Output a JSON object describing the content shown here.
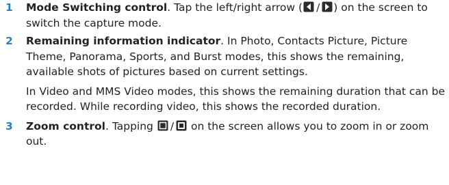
{
  "items": [
    {
      "number": "1",
      "title": "Mode Switching control",
      "text_before": ". Tap the left/right arrow (",
      "slash": "/",
      "text_after": ") on the screen to switch the capture mode.",
      "icons": [
        "left-arrow-icon",
        "right-arrow-icon"
      ]
    },
    {
      "number": "2",
      "title": "Remaining information indicator",
      "text": ". In Photo, Contacts Picture, Picture Theme, Panorama, Sports, and Burst modes, this shows the remaining, available shots of pictures based on current settings.",
      "text2": "In Video and MMS Video modes, this shows the remaining duration that can be recorded. While recording video, this shows the recorded duration."
    },
    {
      "number": "3",
      "title": "Zoom control",
      "text_before": ". Tapping",
      "slash": "/",
      "text_after": "on the screen allows you to zoom in or zoom out.",
      "icons": [
        "zoom-in-icon",
        "zoom-out-icon"
      ]
    }
  ],
  "colors": {
    "number": "#2e7fbf",
    "text": "#222222",
    "icon_dark": "#2b2b2b"
  }
}
